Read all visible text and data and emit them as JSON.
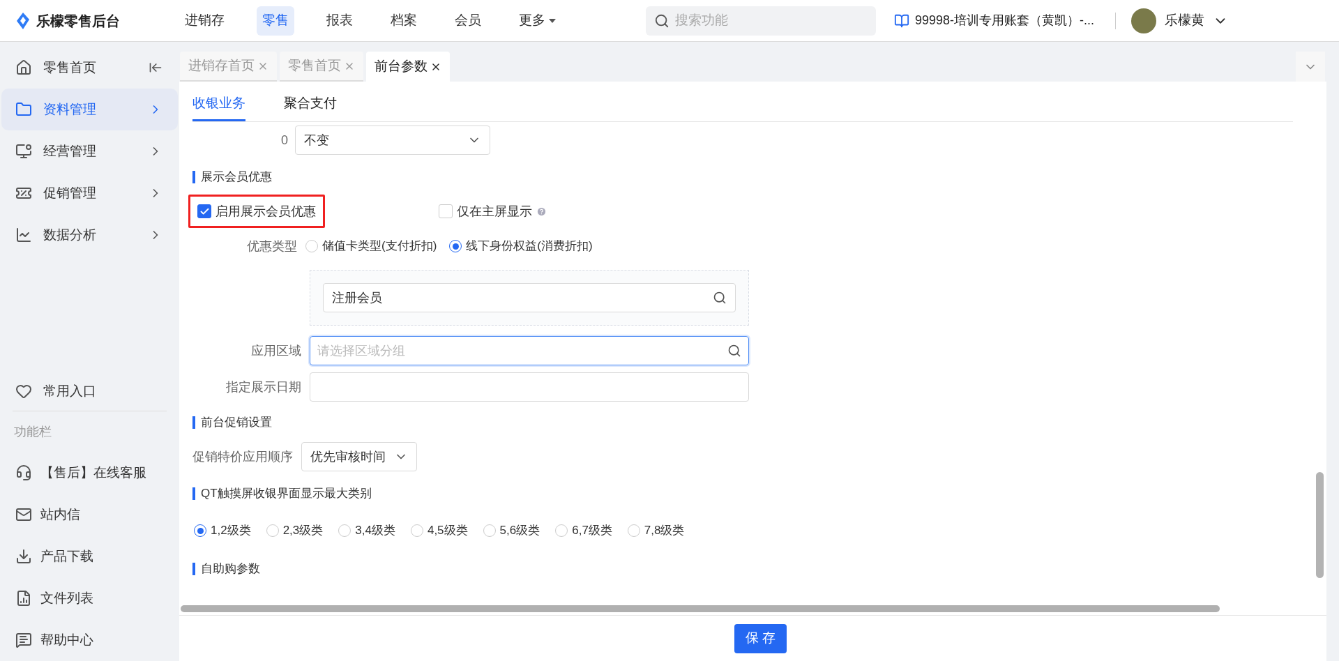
{
  "header": {
    "logo": "乐檬零售后台",
    "nav": [
      {
        "label": "进销存",
        "selected": false,
        "kind": "link"
      },
      {
        "label": "零售",
        "selected": true,
        "kind": "link"
      },
      {
        "label": "报表",
        "selected": false,
        "kind": "link"
      },
      {
        "label": "档案",
        "selected": false,
        "kind": "link"
      },
      {
        "label": "会员",
        "selected": false,
        "kind": "link"
      },
      {
        "label": "更多",
        "selected": false,
        "kind": "menu"
      }
    ],
    "search": {
      "placeholder": "搜索功能"
    },
    "account": "99998-培训专用账套（黄凯）-...",
    "user": "乐檬黄"
  },
  "sidebar": {
    "items": [
      {
        "label": "零售首页",
        "selected": false,
        "kind": "home"
      },
      {
        "label": "资料管理",
        "selected": true,
        "kind": "folder"
      },
      {
        "label": "经营管理",
        "selected": false,
        "kind": "monitor"
      },
      {
        "label": "促销管理",
        "selected": false,
        "kind": "promo"
      },
      {
        "label": "数据分析",
        "selected": false,
        "kind": "chart"
      }
    ],
    "favorites": "常用入口",
    "section_label": "功能栏",
    "tools": [
      {
        "label": "【售后】在线客服",
        "kind": "headset"
      },
      {
        "label": "站内信",
        "kind": "mail"
      },
      {
        "label": "产品下载",
        "kind": "download"
      },
      {
        "label": "文件列表",
        "kind": "file"
      },
      {
        "label": "帮助中心",
        "kind": "help"
      }
    ]
  },
  "tabs": [
    {
      "label": "进销存首页",
      "selected": false
    },
    {
      "label": "零售首页",
      "selected": false
    },
    {
      "label": "前台参数",
      "selected": true
    }
  ],
  "subtabs": [
    {
      "label": "收银业务",
      "selected": true
    },
    {
      "label": "聚合支付",
      "selected": false
    }
  ],
  "form": {
    "top_row": {
      "label": "0",
      "value": "不变"
    },
    "member_section": {
      "title": "展示会员优惠",
      "checkboxes": [
        {
          "label": "启用展示会员优惠",
          "checked": true,
          "highlighted": true
        },
        {
          "label": "仅在主屏显示",
          "checked": false,
          "highlighted": false
        }
      ],
      "discount_type": {
        "label": "优惠类型",
        "options": [
          {
            "label": "储值卡类型(支付折扣)",
            "selected": false
          },
          {
            "label": "线下身份权益(消费折扣)",
            "selected": true
          }
        ]
      },
      "member_level_value": "注册会员",
      "region": {
        "label": "应用区域",
        "placeholder": "请选择区域分组"
      },
      "date": {
        "label": "指定展示日期"
      }
    },
    "promo_section": {
      "title": "前台促销设置",
      "order_label": "促销特价应用顺序",
      "order_value": "优先审核时间"
    },
    "qt_section": {
      "title": "QT触摸屏收银界面显示最大类别",
      "options": [
        {
          "label": "1,2级类",
          "selected": true
        },
        {
          "label": "2,3级类",
          "selected": false
        },
        {
          "label": "3,4级类",
          "selected": false
        },
        {
          "label": "4,5级类",
          "selected": false
        },
        {
          "label": "5,6级类",
          "selected": false
        },
        {
          "label": "6,7级类",
          "selected": false
        },
        {
          "label": "7,8级类",
          "selected": false
        }
      ]
    },
    "selfservice_section": {
      "title": "自助购参数"
    }
  },
  "save_button": "保 存"
}
